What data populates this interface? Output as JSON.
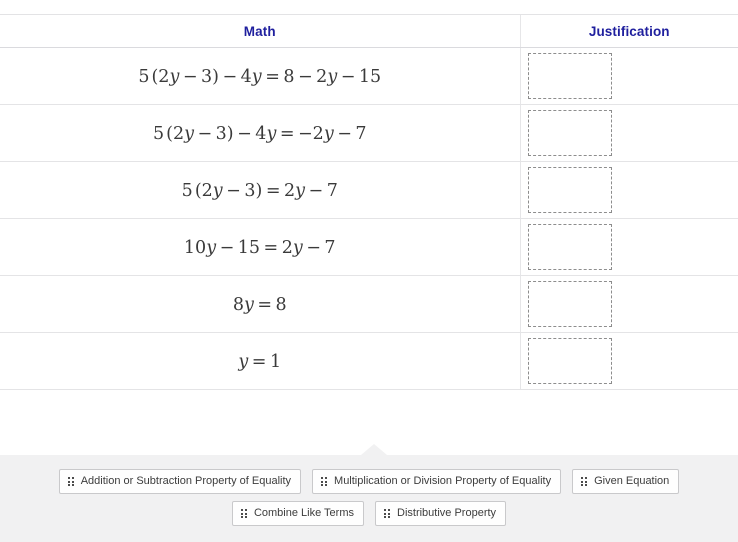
{
  "table": {
    "headers": {
      "math": "Math",
      "justification": "Justification"
    },
    "header_color": "#1f1f9e",
    "rows": [
      {
        "math_plain": "5 (2y - 3) - 4y = 8 - 2y - 15",
        "math_parts": [
          "5",
          "(2",
          "y",
          "−",
          "3)",
          "−",
          "4",
          "y",
          "=",
          "8",
          "−",
          "2",
          "y",
          "−",
          "15"
        ],
        "justification_value": ""
      },
      {
        "math_plain": "5 (2y - 3) - 4y = -2y - 7",
        "math_parts": [
          "5",
          "(2",
          "y",
          "−",
          "3)",
          "−",
          "4",
          "y",
          "=",
          "−2",
          "y",
          "−",
          "7"
        ],
        "justification_value": ""
      },
      {
        "math_plain": "5 (2y - 3) = 2y - 7",
        "math_parts": [
          "5",
          "(2",
          "y",
          "−",
          "3)",
          "=",
          "2",
          "y",
          "−",
          "7"
        ],
        "justification_value": ""
      },
      {
        "math_plain": "10y - 15 = 2y - 7",
        "math_parts": [
          "10",
          "y",
          "−",
          "15",
          "=",
          "2",
          "y",
          "−",
          "7"
        ],
        "justification_value": ""
      },
      {
        "math_plain": "8y = 8",
        "math_parts": [
          "8",
          "y",
          "=",
          "8"
        ],
        "justification_value": ""
      },
      {
        "math_plain": "y = 1",
        "math_parts": [
          "y",
          "=",
          "1"
        ],
        "justification_value": ""
      }
    ]
  },
  "tray": {
    "background_color": "#f1f1f2",
    "rows": [
      [
        {
          "label": "Addition or Subtraction Property of Equality",
          "icon": "drag-grip-icon"
        },
        {
          "label": "Multiplication or Division Property of Equality",
          "icon": "drag-grip-icon"
        },
        {
          "label": "Given Equation",
          "icon": "drag-grip-icon"
        }
      ],
      [
        {
          "label": "Combine Like Terms",
          "icon": "drag-grip-icon"
        },
        {
          "label": "Distributive Property",
          "icon": "drag-grip-icon"
        }
      ]
    ]
  }
}
